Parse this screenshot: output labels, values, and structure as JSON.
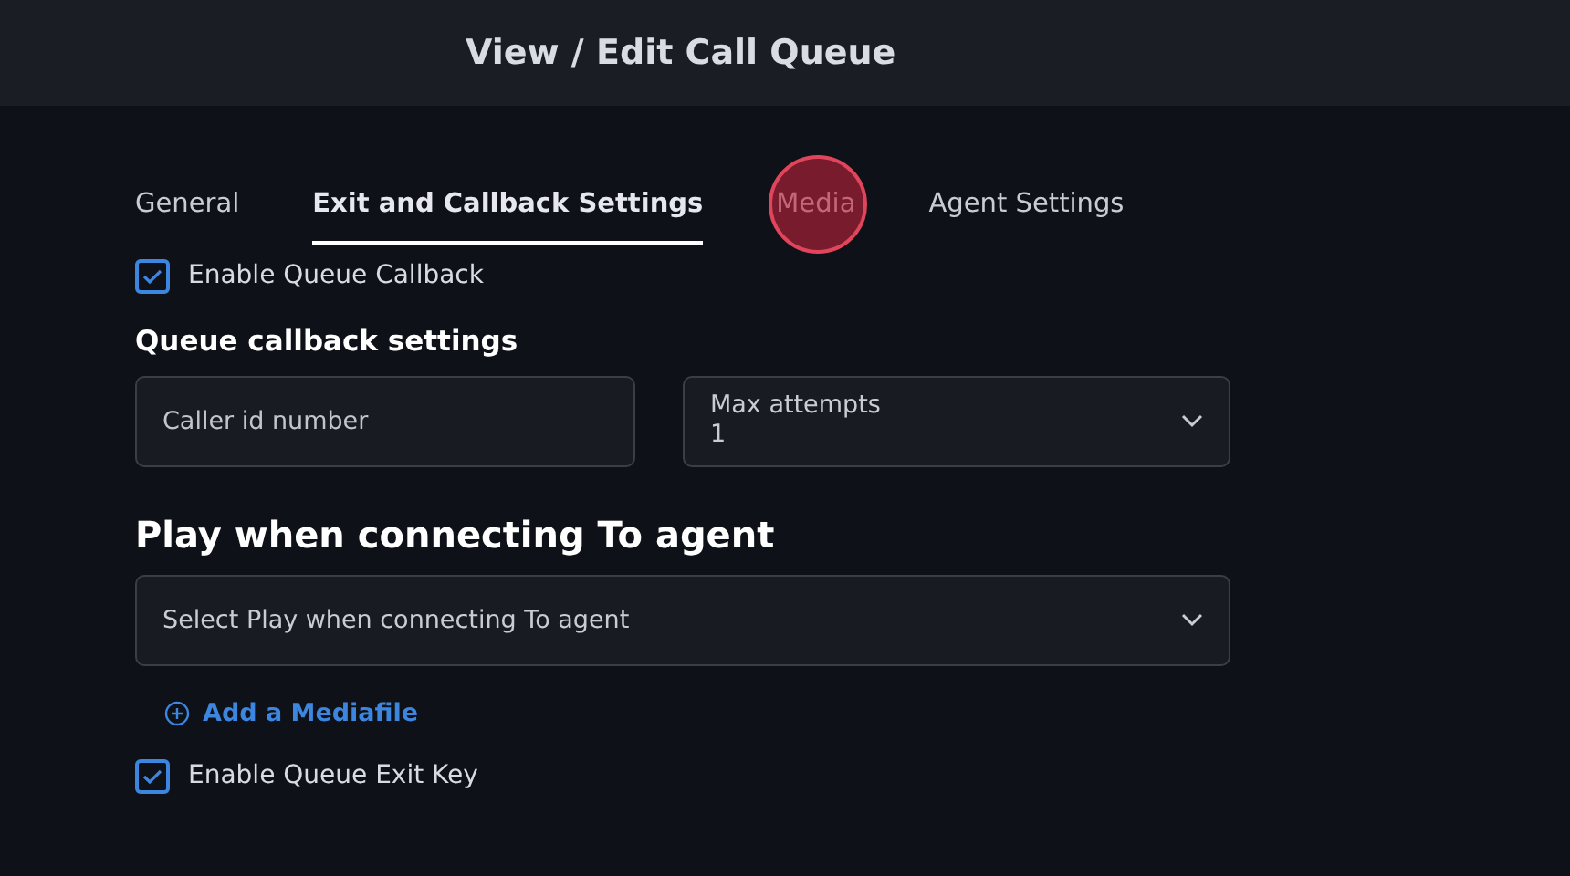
{
  "header": {
    "title": "View / Edit Call Queue"
  },
  "tabs": [
    {
      "label": "General",
      "selected": false
    },
    {
      "label": "Exit and Callback Settings",
      "selected": true
    },
    {
      "label": "Media",
      "selected": false,
      "clicked": true
    },
    {
      "label": "Agent Settings",
      "selected": false
    }
  ],
  "callback_checkbox": {
    "label": "Enable Queue Callback",
    "checked": true
  },
  "callback_section": {
    "title": "Queue callback settings",
    "caller_id": {
      "placeholder": "Caller id number"
    },
    "max_attempts": {
      "label": "Max attempts",
      "value": "1"
    }
  },
  "connect_section": {
    "title": "Play when connecting To agent",
    "select": {
      "placeholder": "Select Play when connecting To agent"
    },
    "add_link": "Add a Mediafile"
  },
  "exit_checkbox": {
    "label": "Enable Queue Exit Key",
    "checked": true
  }
}
